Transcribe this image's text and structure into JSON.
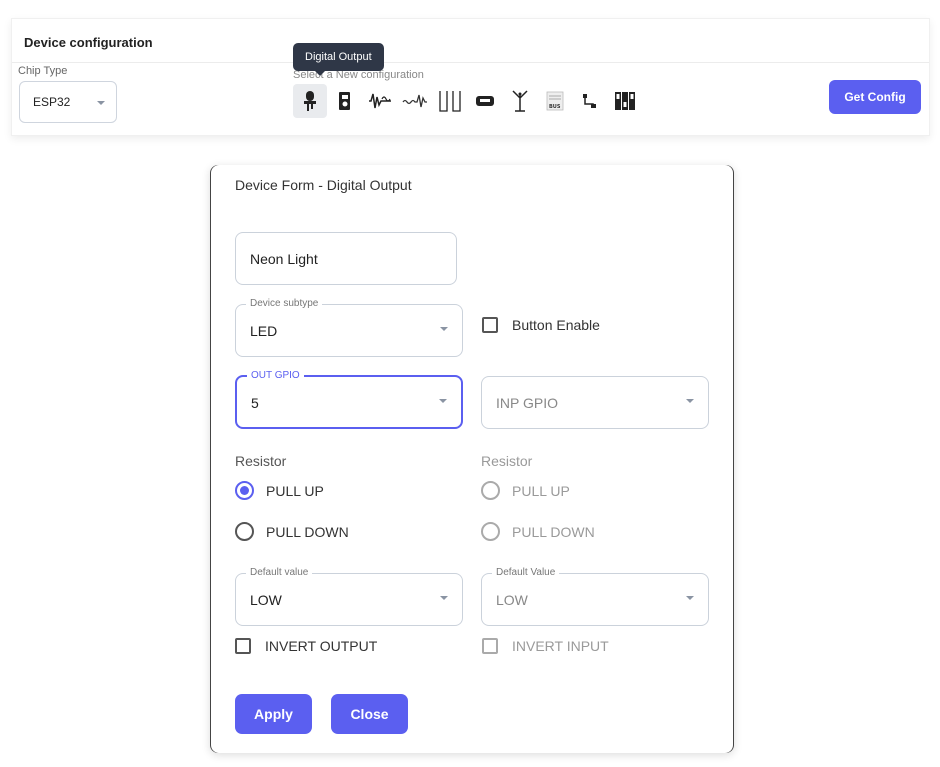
{
  "config_bar": {
    "title": "Device configuration",
    "chip_type_label": "Chip Type",
    "chip_type_value": "ESP32",
    "new_config_label": "Select a New configuration",
    "tooltip": "Digital Output",
    "get_config_label": "Get Config",
    "icons": [
      "digital-output-icon",
      "digital-input-icon",
      "pwm-icon",
      "analog-icon",
      "relay-icon",
      "display-icon",
      "antenna-icon",
      "bus-icon",
      "connector-icon",
      "dip-switch-icon"
    ],
    "accent_color": "#5b5ff0"
  },
  "dialog": {
    "title": "Device Form - Digital Output",
    "device_name": "Neon Light",
    "subtype_legend": "Device subtype",
    "subtype_value": "LED",
    "button_enable_label": "Button Enable",
    "out_gpio_legend": "OUT GPIO",
    "out_gpio_value": "5",
    "inp_gpio_placeholder": "INP GPIO",
    "resistor_left": {
      "label": "Resistor",
      "pull_up": "PULL UP",
      "pull_down": "PULL DOWN",
      "selected": "PULL UP"
    },
    "resistor_right": {
      "label": "Resistor",
      "pull_up": "PULL UP",
      "pull_down": "PULL DOWN"
    },
    "default_value_left_legend": "Default value",
    "default_value_left": "LOW",
    "default_value_right_legend": "Default Value",
    "default_value_right": "LOW",
    "invert_output_label": "INVERT OUTPUT",
    "invert_input_label": "INVERT INPUT",
    "apply_label": "Apply",
    "close_label": "Close"
  }
}
